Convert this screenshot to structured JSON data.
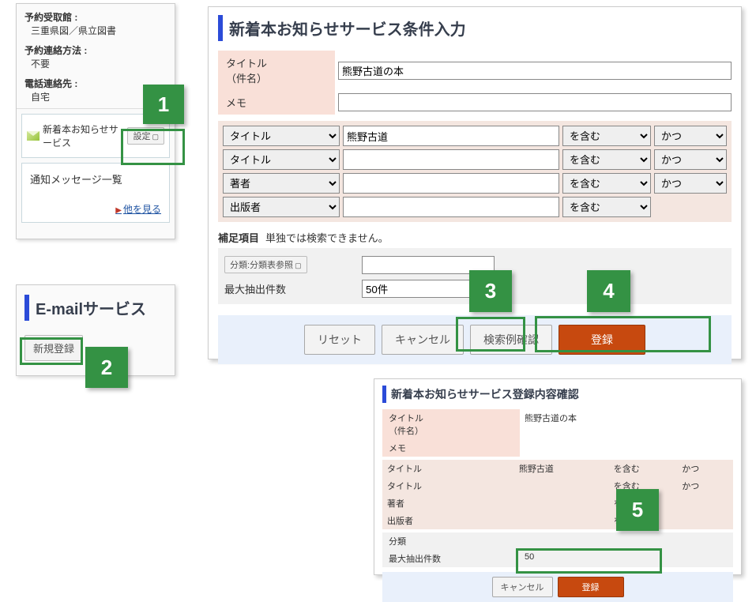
{
  "markers": {
    "m1": "1",
    "m2": "2",
    "m3": "3",
    "m4": "4",
    "m5": "5"
  },
  "side1": {
    "labels": {
      "pickup": "予約受取館 :",
      "contact": "予約連絡方法 :",
      "tel": "電話連絡先 :"
    },
    "values": {
      "pickup": "三重県図／県立図書",
      "contact": "不要",
      "tel": "自宅"
    },
    "notify": {
      "title": "新着本お知らせサービス",
      "btn": "設定"
    },
    "msglist": {
      "title": "通知メッセージ一覧",
      "link": "他を見る"
    }
  },
  "side2": {
    "title": "E-mailサービス",
    "btn": "新規登録"
  },
  "main": {
    "title": "新着本お知らせサービス条件入力",
    "fields": {
      "title": "タイトル\n （件名）",
      "memo": "メモ"
    },
    "values": {
      "title": "熊野古道の本",
      "memo": ""
    },
    "row1": {
      "field": "タイトル",
      "term": "熊野古道",
      "match": "を含む",
      "join": "かつ"
    },
    "row2": {
      "field": "タイトル",
      "term": "",
      "match": "を含む",
      "join": "かつ"
    },
    "row3": {
      "field": "著者",
      "term": "",
      "match": "を含む",
      "join": "かつ"
    },
    "row4": {
      "field": "出版者",
      "term": "",
      "match": "を含む"
    },
    "supp": {
      "head": "補足項目",
      "note": "単独では検索できません。",
      "class": "分類:分類表参照",
      "maxlabel": "最大抽出件数",
      "maxval": "50件"
    },
    "buttons": {
      "reset": "リセット",
      "cancel": "キャンセル",
      "example": "検索例確認",
      "register": "登録"
    }
  },
  "confirm": {
    "title": "新着本お知らせサービス登録内容確認",
    "labels": {
      "title": "タイトル\n （件名）",
      "memo": "メモ",
      "f1": "タイトル",
      "f2": "タイトル",
      "f3": "著者",
      "f4": "出版者",
      "class": "分類",
      "max": "最大抽出件数"
    },
    "values": {
      "title": "熊野古道の本",
      "memo": "",
      "t1": "熊野古道",
      "m": "を含む",
      "j": "かつ",
      "max": "50"
    },
    "buttons": {
      "cancel": "キャンセル",
      "register": "登録"
    }
  }
}
